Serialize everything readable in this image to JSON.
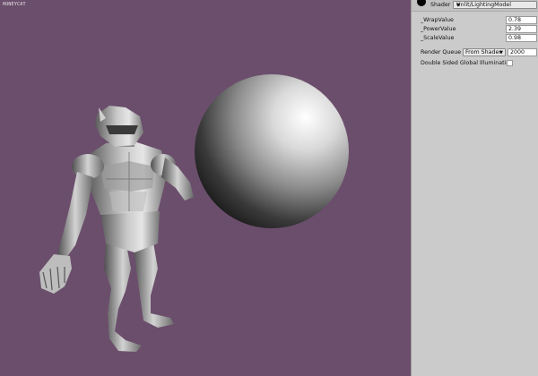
{
  "viewport": {
    "watermark": "HUNEYCAT",
    "background_color": "#6b4e6c"
  },
  "inspector": {
    "shader_label": "Shader",
    "shader_value": "Unlit/LightingModel",
    "properties": [
      {
        "label": "_WrapValue",
        "value": "0.78"
      },
      {
        "label": "_PowerValue",
        "value": "2.39"
      },
      {
        "label": "_ScaleValue",
        "value": "0.98"
      }
    ],
    "render_queue_label": "Render Queue",
    "render_queue_mode": "From Shader",
    "render_queue_value": "2000",
    "dsgi_label": "Double Sided Global Illumination",
    "dsgi_checked": false
  }
}
